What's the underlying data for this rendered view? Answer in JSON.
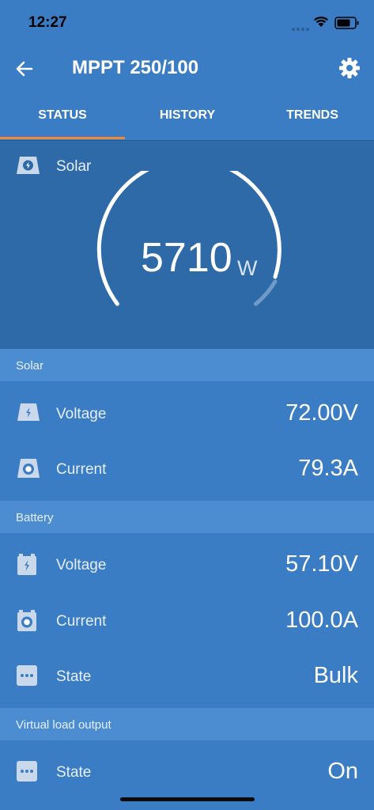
{
  "status_bar": {
    "time": "12:27"
  },
  "app_bar": {
    "title": "MPPT 250/100"
  },
  "tabs": [
    {
      "label": "STATUS",
      "active": true
    },
    {
      "label": "HISTORY",
      "active": false
    },
    {
      "label": "TRENDS",
      "active": false
    }
  ],
  "gauge": {
    "label": "Solar",
    "value": "5710",
    "unit": "W"
  },
  "sections": {
    "solar": {
      "header": "Solar",
      "rows": [
        {
          "label": "Voltage",
          "value": "72.00V",
          "icon": "solar-bolt-icon"
        },
        {
          "label": "Current",
          "value": "79.3A",
          "icon": "solar-current-icon"
        }
      ]
    },
    "battery": {
      "header": "Battery",
      "rows": [
        {
          "label": "Voltage",
          "value": "57.10V",
          "icon": "battery-bolt-icon"
        },
        {
          "label": "Current",
          "value": "100.0A",
          "icon": "battery-current-icon"
        },
        {
          "label": "State",
          "value": "Bulk",
          "icon": "dots-icon"
        }
      ]
    },
    "virtual_load": {
      "header": "Virtual load output",
      "rows": [
        {
          "label": "State",
          "value": "On",
          "icon": "dots-icon"
        }
      ]
    }
  },
  "colors": {
    "background": "#3b7dc4",
    "gauge_panel": "#2f6aa8",
    "section_header": "#4b8dd0",
    "tab_indicator": "#f0883a"
  }
}
